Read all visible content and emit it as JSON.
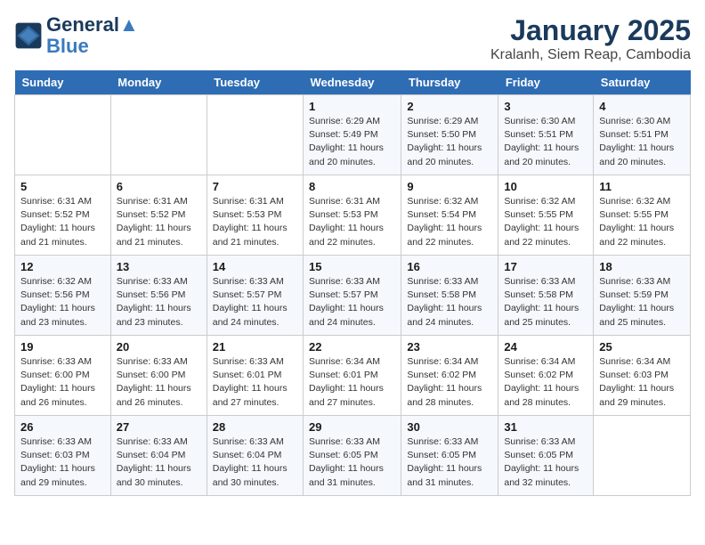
{
  "header": {
    "logo_line1": "General",
    "logo_line2": "Blue",
    "month_title": "January 2025",
    "location": "Kralanh, Siem Reap, Cambodia"
  },
  "days_of_week": [
    "Sunday",
    "Monday",
    "Tuesday",
    "Wednesday",
    "Thursday",
    "Friday",
    "Saturday"
  ],
  "weeks": [
    [
      {
        "num": "",
        "info": ""
      },
      {
        "num": "",
        "info": ""
      },
      {
        "num": "",
        "info": ""
      },
      {
        "num": "1",
        "info": "Sunrise: 6:29 AM\nSunset: 5:49 PM\nDaylight: 11 hours\nand 20 minutes."
      },
      {
        "num": "2",
        "info": "Sunrise: 6:29 AM\nSunset: 5:50 PM\nDaylight: 11 hours\nand 20 minutes."
      },
      {
        "num": "3",
        "info": "Sunrise: 6:30 AM\nSunset: 5:51 PM\nDaylight: 11 hours\nand 20 minutes."
      },
      {
        "num": "4",
        "info": "Sunrise: 6:30 AM\nSunset: 5:51 PM\nDaylight: 11 hours\nand 20 minutes."
      }
    ],
    [
      {
        "num": "5",
        "info": "Sunrise: 6:31 AM\nSunset: 5:52 PM\nDaylight: 11 hours\nand 21 minutes."
      },
      {
        "num": "6",
        "info": "Sunrise: 6:31 AM\nSunset: 5:52 PM\nDaylight: 11 hours\nand 21 minutes."
      },
      {
        "num": "7",
        "info": "Sunrise: 6:31 AM\nSunset: 5:53 PM\nDaylight: 11 hours\nand 21 minutes."
      },
      {
        "num": "8",
        "info": "Sunrise: 6:31 AM\nSunset: 5:53 PM\nDaylight: 11 hours\nand 22 minutes."
      },
      {
        "num": "9",
        "info": "Sunrise: 6:32 AM\nSunset: 5:54 PM\nDaylight: 11 hours\nand 22 minutes."
      },
      {
        "num": "10",
        "info": "Sunrise: 6:32 AM\nSunset: 5:55 PM\nDaylight: 11 hours\nand 22 minutes."
      },
      {
        "num": "11",
        "info": "Sunrise: 6:32 AM\nSunset: 5:55 PM\nDaylight: 11 hours\nand 22 minutes."
      }
    ],
    [
      {
        "num": "12",
        "info": "Sunrise: 6:32 AM\nSunset: 5:56 PM\nDaylight: 11 hours\nand 23 minutes."
      },
      {
        "num": "13",
        "info": "Sunrise: 6:33 AM\nSunset: 5:56 PM\nDaylight: 11 hours\nand 23 minutes."
      },
      {
        "num": "14",
        "info": "Sunrise: 6:33 AM\nSunset: 5:57 PM\nDaylight: 11 hours\nand 24 minutes."
      },
      {
        "num": "15",
        "info": "Sunrise: 6:33 AM\nSunset: 5:57 PM\nDaylight: 11 hours\nand 24 minutes."
      },
      {
        "num": "16",
        "info": "Sunrise: 6:33 AM\nSunset: 5:58 PM\nDaylight: 11 hours\nand 24 minutes."
      },
      {
        "num": "17",
        "info": "Sunrise: 6:33 AM\nSunset: 5:58 PM\nDaylight: 11 hours\nand 25 minutes."
      },
      {
        "num": "18",
        "info": "Sunrise: 6:33 AM\nSunset: 5:59 PM\nDaylight: 11 hours\nand 25 minutes."
      }
    ],
    [
      {
        "num": "19",
        "info": "Sunrise: 6:33 AM\nSunset: 6:00 PM\nDaylight: 11 hours\nand 26 minutes."
      },
      {
        "num": "20",
        "info": "Sunrise: 6:33 AM\nSunset: 6:00 PM\nDaylight: 11 hours\nand 26 minutes."
      },
      {
        "num": "21",
        "info": "Sunrise: 6:33 AM\nSunset: 6:01 PM\nDaylight: 11 hours\nand 27 minutes."
      },
      {
        "num": "22",
        "info": "Sunrise: 6:34 AM\nSunset: 6:01 PM\nDaylight: 11 hours\nand 27 minutes."
      },
      {
        "num": "23",
        "info": "Sunrise: 6:34 AM\nSunset: 6:02 PM\nDaylight: 11 hours\nand 28 minutes."
      },
      {
        "num": "24",
        "info": "Sunrise: 6:34 AM\nSunset: 6:02 PM\nDaylight: 11 hours\nand 28 minutes."
      },
      {
        "num": "25",
        "info": "Sunrise: 6:34 AM\nSunset: 6:03 PM\nDaylight: 11 hours\nand 29 minutes."
      }
    ],
    [
      {
        "num": "26",
        "info": "Sunrise: 6:33 AM\nSunset: 6:03 PM\nDaylight: 11 hours\nand 29 minutes."
      },
      {
        "num": "27",
        "info": "Sunrise: 6:33 AM\nSunset: 6:04 PM\nDaylight: 11 hours\nand 30 minutes."
      },
      {
        "num": "28",
        "info": "Sunrise: 6:33 AM\nSunset: 6:04 PM\nDaylight: 11 hours\nand 30 minutes."
      },
      {
        "num": "29",
        "info": "Sunrise: 6:33 AM\nSunset: 6:05 PM\nDaylight: 11 hours\nand 31 minutes."
      },
      {
        "num": "30",
        "info": "Sunrise: 6:33 AM\nSunset: 6:05 PM\nDaylight: 11 hours\nand 31 minutes."
      },
      {
        "num": "31",
        "info": "Sunrise: 6:33 AM\nSunset: 6:05 PM\nDaylight: 11 hours\nand 32 minutes."
      },
      {
        "num": "",
        "info": ""
      }
    ]
  ]
}
